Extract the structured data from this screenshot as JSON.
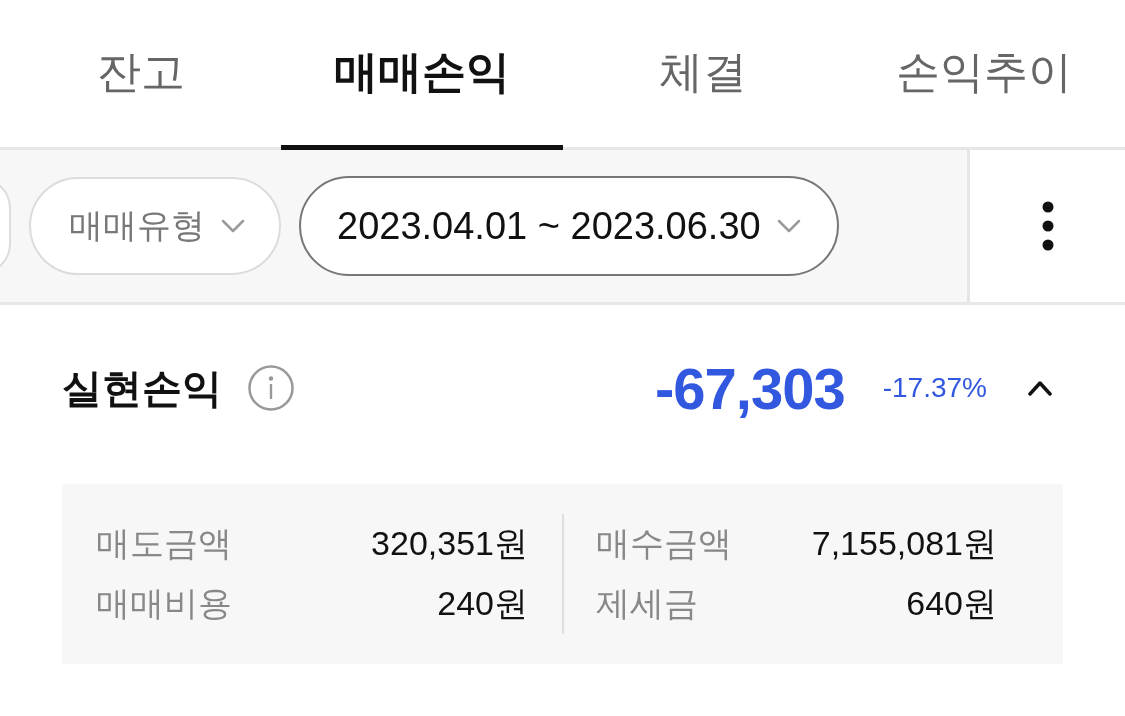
{
  "tabs": [
    {
      "label": "잔고",
      "selected": false
    },
    {
      "label": "매매손익",
      "selected": true
    },
    {
      "label": "체결",
      "selected": false
    },
    {
      "label": "손익추이",
      "selected": false
    }
  ],
  "filters": {
    "chips": [
      {
        "label": "매매유형",
        "active": false
      },
      {
        "label": "2023.04.01 ~ 2023.06.30",
        "active": true
      }
    ]
  },
  "summary": {
    "title": "실현손익",
    "amount": "-67,303",
    "rate": "-17.37%",
    "expanded": true,
    "columns": [
      {
        "rows": [
          {
            "label": "매도금액",
            "value": "320,351원"
          },
          {
            "label": "매매비용",
            "value": "240원"
          }
        ]
      },
      {
        "rows": [
          {
            "label": "매수금액",
            "value": "7,155,081원"
          },
          {
            "label": "제세금",
            "value": "640원"
          }
        ]
      }
    ]
  }
}
